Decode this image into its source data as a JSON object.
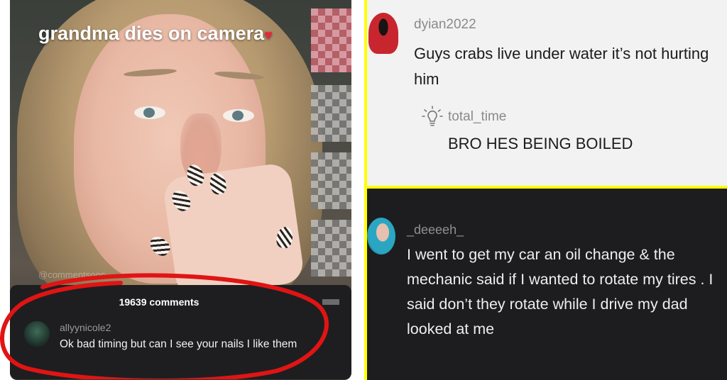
{
  "left_panel": {
    "caption": "grandma dies on camera",
    "caption_emoji": "♥",
    "watermark": "@commentsooc",
    "comments": {
      "count_label": "19639 comments",
      "comment": {
        "username": "allyynicole2",
        "text": "Ok bad timing but can I see your nails I like them"
      }
    },
    "highlight_color": "#e01414"
  },
  "top_right_panel": {
    "comment": {
      "username": "dyian2022",
      "text": "Guys crabs live under water it’s not hurting him"
    },
    "reply": {
      "username": "total_time",
      "text": "BRO HES BEING BOILED"
    },
    "border_color": "#ffff00",
    "avatar_icon": "person-avatar-icon",
    "reply_icon": "lightbulb-icon"
  },
  "bottom_right_panel": {
    "comment": {
      "username": "_deeeeh_",
      "text": "I went to get my car an oil change & the mechanic said if I wanted to rotate my tires . I said don’t they rotate while I drive my dad looked at me"
    }
  }
}
